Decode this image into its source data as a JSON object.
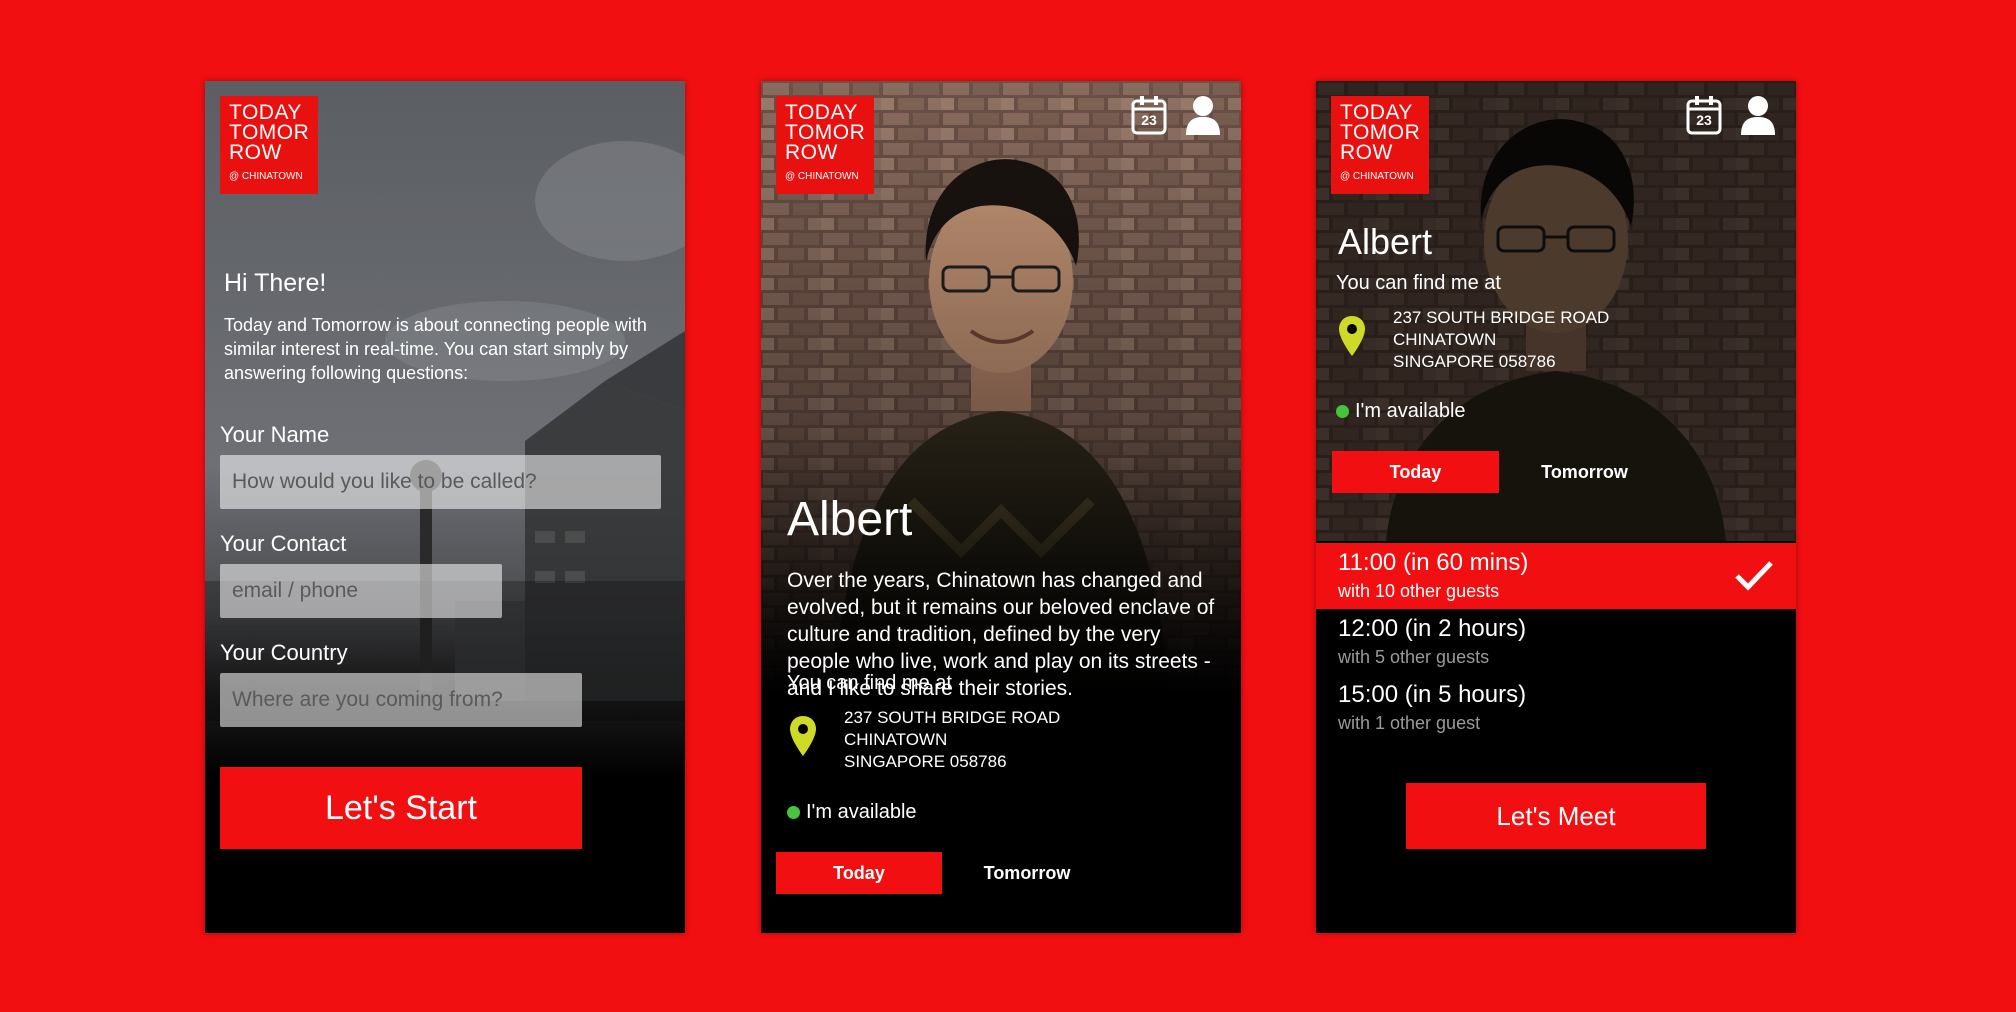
{
  "logo": {
    "line1": "TODAY",
    "line2": "TOMOR",
    "line3": "ROW",
    "sub": "@ CHINATOWN"
  },
  "colors": {
    "brand_red": "#f20f12",
    "pin_yellow": "#cfd928",
    "available_green": "#45c43c"
  },
  "calendar_day": "23",
  "screen1": {
    "greeting": "Hi There!",
    "intro": "Today and Tomorrow is about connecting people with similar interest in real-time. You can start simply by answering following questions:",
    "name_label": "Your Name",
    "name_placeholder": "How would you like to be called?",
    "contact_label": "Your Contact",
    "contact_placeholder": "email / phone",
    "country_label": "Your Country",
    "country_placeholder": "Where are you coming from?",
    "start_button": "Let's Start"
  },
  "profile": {
    "name": "Albert",
    "bio": "Over the years, Chinatown has changed and evolved, but it remains our beloved enclave of culture and tradition, defined by the very people who live, work and play on its streets - and I like to share their stories.",
    "find_me": "You can find me at",
    "address": [
      "237 SOUTH BRIDGE ROAD",
      "CHINATOWN",
      "SINGAPORE 058786"
    ],
    "availability": "I'm available",
    "tabs": [
      "Today",
      "Tomorrow"
    ]
  },
  "slots": [
    {
      "time": "11:00 (in 60 mins)",
      "guests": "with 10 other guests",
      "selected": true
    },
    {
      "time": "12:00 (in 2 hours)",
      "guests": "with 5 other guests",
      "selected": false
    },
    {
      "time": "15:00 (in 5 hours)",
      "guests": "with 1 other guest",
      "selected": false
    }
  ],
  "meet_button": "Let's Meet"
}
